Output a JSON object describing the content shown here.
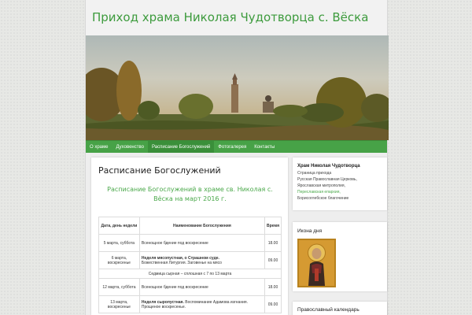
{
  "site": {
    "title": "Приход храма Николая Чудотворца с. Вёска"
  },
  "nav": [
    "О храме",
    "Духовенство",
    "Расписание Богослужений",
    "Фотогалерея",
    "Контакты"
  ],
  "main": {
    "title": "Расписание Богослужений",
    "heading": "Расписание Богослужений в храме св. Николая с. Вёска на март 2016 г.",
    "table": {
      "headers": [
        "Дата, день недели",
        "Наименование Богослужения",
        "Время"
      ],
      "rows": [
        {
          "date": "5 марта, суббота",
          "bold": "",
          "text": "Всенощное бдение под воскресение",
          "time": "18.00"
        },
        {
          "date": "6 марта, воскресенье",
          "bold": "Неделя мясопустная, о Страшном суде.",
          "text": "Божественная Литургия. Заговенье на мясо",
          "time": "09.00"
        },
        {
          "span": "Седмица сырная – сплошная с 7 по 13 марта"
        },
        {
          "date": "12 марта, суббота",
          "bold": "",
          "text": "Всенощное бдение под воскресение",
          "time": "18.00"
        },
        {
          "date": "13 марта, воскресенье",
          "bold": "Неделя сыропустная.",
          "text": "Воспоминание Адамова изгнания. Прощеное воскресенье.",
          "time": "09.00"
        }
      ]
    }
  },
  "sidebar": {
    "w1": {
      "title": "Храм Николая Чудотворца",
      "lines": [
        {
          "text": "Страница прихода",
          "link": false
        },
        {
          "text": "Русская Православная Церковь,",
          "link": false
        },
        {
          "text": "Ярославская митрополия,",
          "link": false
        },
        {
          "text": "Переславская епархия,",
          "link": true
        },
        {
          "text": "Борисоглебское благочиние",
          "link": false
        }
      ]
    },
    "w2": {
      "title": "Икона дня"
    },
    "w3": {
      "title": "Православный календарь"
    }
  },
  "colors": {
    "accent": "#47a247",
    "link": "#4aa84a"
  }
}
